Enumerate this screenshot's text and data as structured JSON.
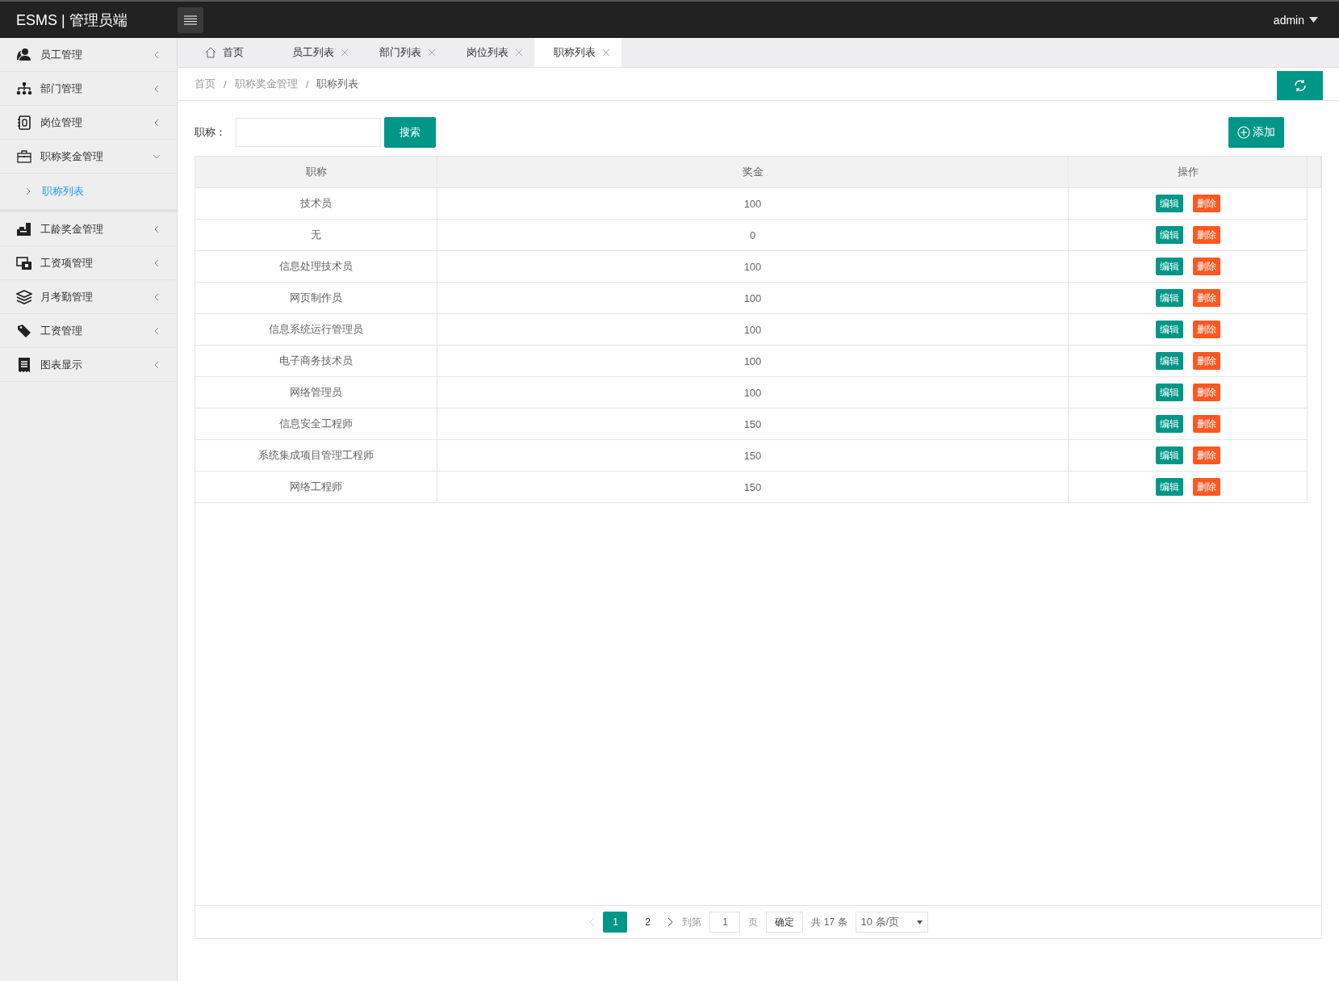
{
  "header": {
    "brand": "ESMS | 管理员端",
    "user": "admin"
  },
  "sidebar": {
    "items": [
      {
        "label": "员工管理",
        "expanded": false
      },
      {
        "label": "部门管理",
        "expanded": false
      },
      {
        "label": "岗位管理",
        "expanded": false
      },
      {
        "label": "职称奖金管理",
        "expanded": true,
        "children": [
          {
            "label": "职称列表",
            "selected": true
          }
        ]
      },
      {
        "label": "工龄奖金管理",
        "expanded": false
      },
      {
        "label": "工资项管理",
        "expanded": false
      },
      {
        "label": "月考勤管理",
        "expanded": false
      },
      {
        "label": "工资管理",
        "expanded": false
      },
      {
        "label": "图表显示",
        "expanded": false
      }
    ]
  },
  "tabs": [
    {
      "label": "首页",
      "kind": "home",
      "selected": false
    },
    {
      "label": "员工列表",
      "kind": "closable",
      "selected": false
    },
    {
      "label": "部门列表",
      "kind": "closable",
      "selected": false
    },
    {
      "label": "岗位列表",
      "kind": "closable",
      "selected": false
    },
    {
      "label": "职称列表",
      "kind": "closable",
      "selected": true
    }
  ],
  "breadcrumb": {
    "items": [
      "首页",
      "职称奖金管理",
      "职称列表"
    ],
    "separator": "/"
  },
  "search": {
    "label": "职称：",
    "button": "搜索"
  },
  "add_button": "添加",
  "table": {
    "columns": [
      "职称",
      "奖金",
      "操作"
    ],
    "rows": [
      {
        "title": "技术员",
        "bonus": "100",
        "edit": "编辑",
        "delete": "删除"
      },
      {
        "title": "无",
        "bonus": "0",
        "edit": "编辑",
        "delete": "删除"
      },
      {
        "title": "信息处理技术员",
        "bonus": "100",
        "edit": "编辑",
        "delete": "删除"
      },
      {
        "title": "网页制作员",
        "bonus": "100",
        "edit": "编辑",
        "delete": "删除"
      },
      {
        "title": "信息系统运行管理员",
        "bonus": "100",
        "edit": "编辑",
        "delete": "删除"
      },
      {
        "title": "电子商务技术员",
        "bonus": "100",
        "edit": "编辑",
        "delete": "删除"
      },
      {
        "title": "网络管理员",
        "bonus": "100",
        "edit": "编辑",
        "delete": "删除"
      },
      {
        "title": "信息安全工程师",
        "bonus": "150",
        "edit": "编辑",
        "delete": "删除"
      },
      {
        "title": "系统集成项目管理工程师",
        "bonus": "150",
        "edit": "编辑",
        "delete": "删除"
      },
      {
        "title": "网络工程师",
        "bonus": "150",
        "edit": "编辑",
        "delete": "删除"
      }
    ]
  },
  "pagination": {
    "pages": [
      {
        "label": "1",
        "selected": true
      },
      {
        "label": "2",
        "selected": false
      }
    ],
    "goto_label": "到第",
    "goto_value": "1",
    "page_unit": "页",
    "confirm": "确定",
    "total": "共 17 条",
    "page_size": "10 条/页"
  }
}
